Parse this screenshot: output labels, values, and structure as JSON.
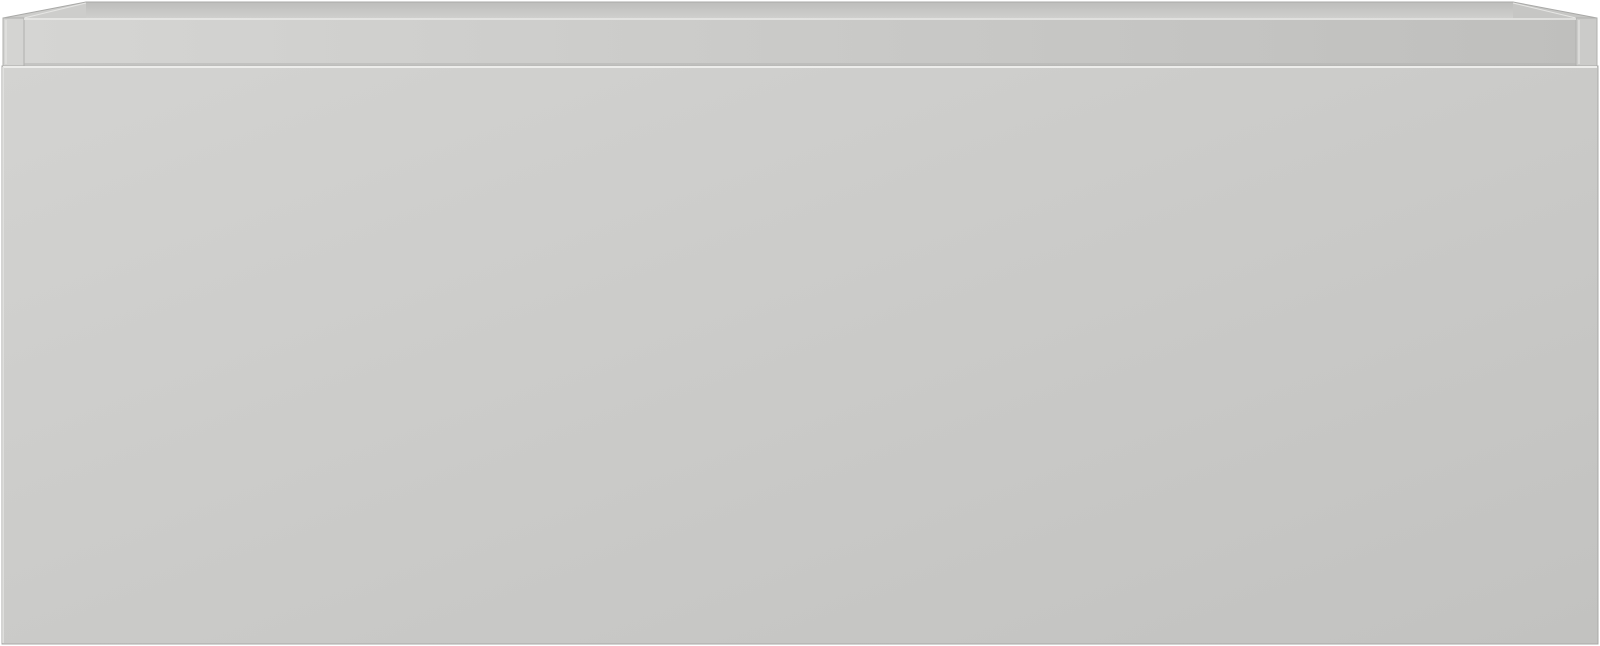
{
  "object": {
    "kind": "drawer-unit",
    "colors": {
      "front_light": "#d3d3d1",
      "front_dark": "#c2c2c0",
      "box_inner_light": "#d5d5d3",
      "box_inner_dark": "#bfbfbd",
      "edge_highlight": "#ededeb",
      "outline": "#a9a9a7",
      "shadow_line": "#b3b3b1"
    }
  }
}
